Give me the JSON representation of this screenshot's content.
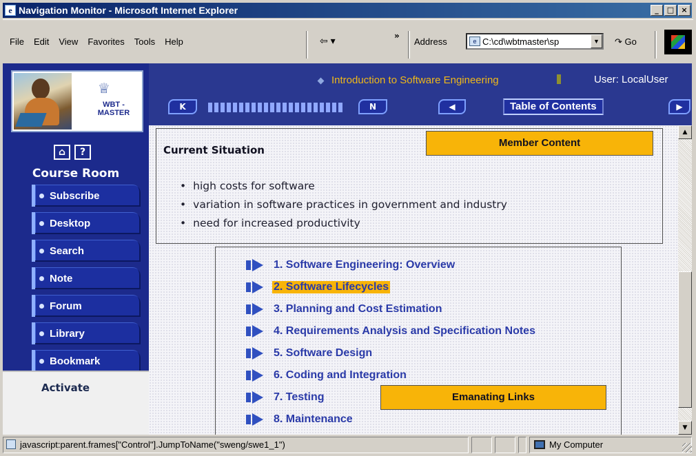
{
  "window": {
    "title": "Navigation Monitor - Microsoft Internet Explorer",
    "controls": [
      "_",
      "□",
      "×"
    ]
  },
  "menubar": {
    "items": [
      "File",
      "Edit",
      "View",
      "Favorites",
      "Tools",
      "Help"
    ],
    "back_label": "⇦ ▾",
    "more": "»",
    "address_label": "Address",
    "address_value": "C:\\cd\\wbtmaster\\sp",
    "go_label": "Go"
  },
  "sidebar": {
    "logo_text": "WBT - MASTER",
    "home_icon": "⌂",
    "help_icon": "?",
    "section_title": "Course Room",
    "items": [
      {
        "label": "Subscribe"
      },
      {
        "label": "Desktop"
      },
      {
        "label": "Search"
      },
      {
        "label": "Note"
      },
      {
        "label": "Forum"
      },
      {
        "label": "Library"
      },
      {
        "label": "Bookmark"
      }
    ],
    "activate_label": "Activate"
  },
  "header": {
    "course_title": "Introduction to Software Engineering",
    "user_label": "User: LocalUser",
    "first_icon": "K",
    "last_icon": "N",
    "prev_icon": "◀",
    "next_icon": "▶",
    "toc_label": "Table of Contents"
  },
  "content": {
    "situation_title": "Current Situation",
    "member_content_label": "Member Content",
    "bullets": [
      "high costs for software",
      "variation in software practices in government and industry",
      "need for increased productivity"
    ],
    "toc": [
      {
        "label": "1. Software Engineering: Overview",
        "highlighted": false
      },
      {
        "label": "2. Software Lifecycles",
        "highlighted": true
      },
      {
        "label": "3. Planning and Cost Estimation",
        "highlighted": false
      },
      {
        "label": "4. Requirements Analysis and Specification Notes",
        "highlighted": false
      },
      {
        "label": "5. Software Design",
        "highlighted": false
      },
      {
        "label": "6. Coding and Integration",
        "highlighted": false
      },
      {
        "label": "7. Testing",
        "highlighted": false
      },
      {
        "label": "8. Maintenance",
        "highlighted": false
      }
    ],
    "emanating_links_label": "Emanating Links"
  },
  "statusbar": {
    "url_text": "javascript:parent.frames[\"Control\"].JumpToName(\"sweng/swe1_1\")",
    "zone_text": "My Computer"
  },
  "colors": {
    "accent_yellow": "#f8b408",
    "panel_blue": "#1c2a8c",
    "link_blue": "#2a3aa8"
  }
}
